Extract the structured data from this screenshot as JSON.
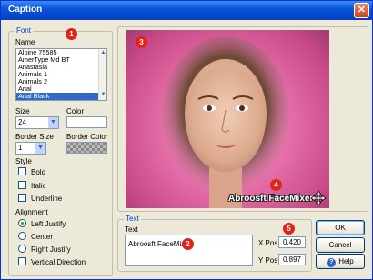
{
  "window": {
    "title": "Caption",
    "close_glyph": "✕"
  },
  "font_group": {
    "label": "Font",
    "name_label": "Name",
    "fonts": [
      "Alpine 75585",
      "AmerType Md BT",
      "Anastasia",
      "Animals 1",
      "Animals 2",
      "Arial",
      "Arial Black"
    ],
    "selected_index": 6,
    "size_label": "Size",
    "size_value": "24",
    "color_label": "Color",
    "border_size_label": "Border Size",
    "border_size_value": "1",
    "border_color_label": "Border Color",
    "style_label": "Style",
    "styles": [
      "Bold",
      "Italic",
      "Underline"
    ],
    "alignment_label": "Alignment",
    "alignments": [
      "Left Justify",
      "Center",
      "Right Justify"
    ],
    "selected_alignment": 0,
    "vertical_direction_label": "Vertical Direction"
  },
  "preview": {
    "overlay_text": "Abroosft FaceMixer"
  },
  "text_group": {
    "label": "Text",
    "text_label": "Text",
    "text_value": "Abroosft FaceMixer",
    "xpos_label": "X Pos:",
    "xpos_value": "0.420",
    "ypos_label": "Y Pos:",
    "ypos_value": "0.897"
  },
  "buttons": {
    "ok": "OK",
    "cancel": "Cancel",
    "help": "Help"
  },
  "callouts": [
    "1",
    "2",
    "3",
    "4",
    "5"
  ],
  "colors": {
    "accent": "#0046d5",
    "badge": "#e2231a",
    "selection": "#316ac5",
    "preview_pink": "#e46ea8"
  }
}
